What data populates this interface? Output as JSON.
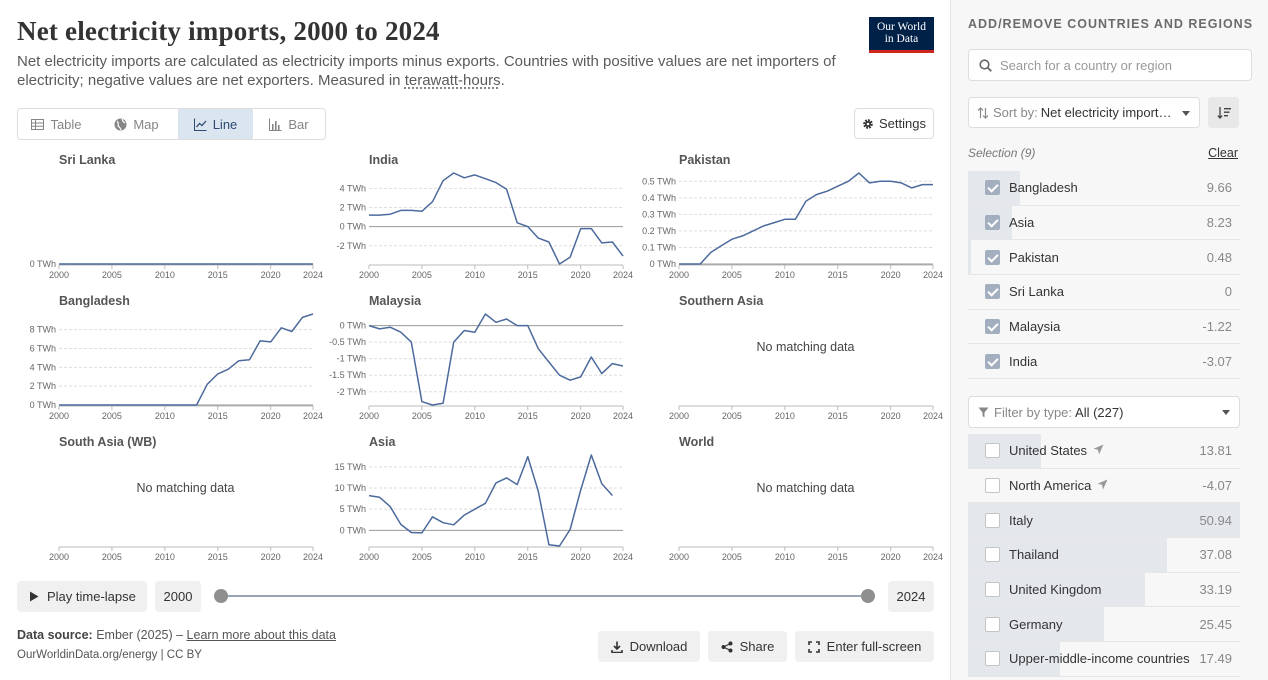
{
  "title": "Net electricity imports, 2000 to 2024",
  "subtitle_text": "Net electricity imports are calculated as electricity imports minus exports. Countries with positive values are net importers of electricity; negative values are net exporters. Measured in ",
  "subtitle_link": "terawatt-hours",
  "subtitle_end": ".",
  "logo": {
    "line1": "Our World",
    "line2": "in Data"
  },
  "tabs": [
    {
      "label": "Table",
      "icon": "table-icon"
    },
    {
      "label": "Map",
      "icon": "globe-icon"
    },
    {
      "label": "Line",
      "icon": "line-chart-icon",
      "active": true
    },
    {
      "label": "Bar",
      "icon": "bar-chart-icon"
    }
  ],
  "settings_label": "Settings",
  "no_data_label": "No matching data",
  "chart_data": [
    {
      "type": "line",
      "title": "Sri Lanka",
      "x": [
        2000,
        2024
      ],
      "y": [
        0,
        0
      ],
      "yticks": [
        0
      ],
      "ylim": [
        0,
        0.1
      ],
      "unit": "TWh"
    },
    {
      "type": "line",
      "title": "India",
      "x": [
        2000,
        2001,
        2002,
        2003,
        2004,
        2005,
        2006,
        2007,
        2008,
        2009,
        2010,
        2011,
        2012,
        2013,
        2014,
        2015,
        2016,
        2017,
        2018,
        2019,
        2020,
        2021,
        2022,
        2023,
        2024
      ],
      "y": [
        1.2,
        1.2,
        1.3,
        1.7,
        1.7,
        1.6,
        2.6,
        4.8,
        5.6,
        5.1,
        5.4,
        5.0,
        4.6,
        3.9,
        0.4,
        0.0,
        -1.2,
        -1.6,
        -3.9,
        -3.2,
        -0.2,
        -0.2,
        -1.7,
        -1.6,
        -3.07
      ],
      "yticks": [
        -2,
        0,
        2,
        4
      ],
      "ylim": [
        -3.9,
        5.6
      ],
      "unit": "TWh"
    },
    {
      "type": "line",
      "title": "Pakistan",
      "x": [
        2000,
        2001,
        2002,
        2003,
        2004,
        2005,
        2006,
        2007,
        2008,
        2009,
        2010,
        2011,
        2012,
        2013,
        2014,
        2015,
        2016,
        2017,
        2018,
        2019,
        2020,
        2021,
        2022,
        2023,
        2024
      ],
      "y": [
        0,
        0,
        0,
        0.07,
        0.11,
        0.15,
        0.17,
        0.2,
        0.23,
        0.25,
        0.27,
        0.27,
        0.38,
        0.42,
        0.44,
        0.47,
        0.5,
        0.55,
        0.49,
        0.5,
        0.5,
        0.49,
        0.46,
        0.48,
        0.48
      ],
      "yticks": [
        0,
        0.1,
        0.2,
        0.3,
        0.4,
        0.5
      ],
      "ylim": [
        0,
        0.55
      ],
      "unit": "TWh"
    },
    {
      "type": "line",
      "title": "Bangladesh",
      "x": [
        2000,
        2001,
        2002,
        2003,
        2004,
        2005,
        2006,
        2007,
        2008,
        2009,
        2010,
        2011,
        2012,
        2013,
        2014,
        2015,
        2016,
        2017,
        2018,
        2019,
        2020,
        2021,
        2022,
        2023,
        2024
      ],
      "y": [
        0,
        0,
        0,
        0,
        0,
        0,
        0,
        0,
        0,
        0,
        0,
        0,
        0,
        0,
        2.2,
        3.3,
        3.8,
        4.7,
        4.8,
        6.8,
        6.7,
        8.2,
        7.8,
        9.3,
        9.66
      ],
      "yticks": [
        0,
        2,
        4,
        6,
        8
      ],
      "ylim": [
        0,
        9.66
      ],
      "unit": "TWh"
    },
    {
      "type": "line",
      "title": "Malaysia",
      "x": [
        2000,
        2001,
        2002,
        2003,
        2004,
        2005,
        2006,
        2007,
        2008,
        2009,
        2010,
        2011,
        2012,
        2013,
        2014,
        2015,
        2016,
        2017,
        2018,
        2019,
        2020,
        2021,
        2022,
        2023,
        2024
      ],
      "y": [
        0,
        -0.1,
        -0.05,
        -0.2,
        -0.5,
        -2.3,
        -2.4,
        -2.35,
        -0.5,
        -0.15,
        -0.2,
        0.35,
        0.1,
        0.2,
        0.0,
        0.0,
        -0.7,
        -1.1,
        -1.5,
        -1.65,
        -1.55,
        -0.95,
        -1.45,
        -1.15,
        -1.22
      ],
      "yticks": [
        -2,
        -1.5,
        -1,
        -0.5,
        0
      ],
      "ylim": [
        -2.4,
        0.35
      ],
      "unit": "TWh"
    },
    {
      "type": "line",
      "title": "Southern Asia",
      "no_data": true
    },
    {
      "type": "line",
      "title": "South Asia (WB)",
      "no_data": true
    },
    {
      "type": "line",
      "title": "Asia",
      "x": [
        2000,
        2001,
        2002,
        2003,
        2004,
        2005,
        2006,
        2007,
        2008,
        2009,
        2010,
        2011,
        2012,
        2013,
        2014,
        2015,
        2016,
        2017,
        2018,
        2019,
        2020,
        2021,
        2022,
        2023,
        2024
      ],
      "y": [
        8.2,
        7.8,
        5.6,
        1.4,
        -0.5,
        -0.6,
        3.2,
        1.8,
        1.3,
        3.6,
        5.0,
        6.4,
        11.2,
        12.4,
        10.8,
        17.4,
        9.2,
        -3.4,
        -3.7,
        0.2,
        9.5,
        17.8,
        11.0,
        8.23
      ],
      "yticks": [
        0,
        5,
        10,
        15
      ],
      "ylim": [
        -3.7,
        17.8
      ],
      "unit": "TWh"
    },
    {
      "type": "line",
      "title": "World",
      "no_data": true
    }
  ],
  "xticks": [
    "2000",
    "2005",
    "2010",
    "2015",
    "2020",
    "2024"
  ],
  "timeline": {
    "play_label": "Play time-lapse",
    "start": "2000",
    "end": "2024"
  },
  "source": {
    "label": "Data source:",
    "text": "Ember (2025) – ",
    "link": "Learn more about this data"
  },
  "url_text": "OurWorldinData.org/energy | CC BY",
  "actions": {
    "download": "Download",
    "share": "Share",
    "fullscreen": "Enter full-screen"
  },
  "sidebar": {
    "title": "ADD/REMOVE COUNTRIES AND REGIONS",
    "search_placeholder": "Search for a country or region",
    "sort_label": "Sort by:",
    "sort_value": "Net electricity import…",
    "selection_label": "Selection (9)",
    "clear_label": "Clear",
    "selected": [
      {
        "name": "Bangladesh",
        "value": "9.66",
        "frac": 0.19
      },
      {
        "name": "Asia",
        "value": "8.23",
        "frac": 0.16
      },
      {
        "name": "Pakistan",
        "value": "0.48",
        "frac": 0.01
      },
      {
        "name": "Sri Lanka",
        "value": "0",
        "frac": 0
      },
      {
        "name": "Malaysia",
        "value": "-1.22",
        "frac": 0
      },
      {
        "name": "India",
        "value": "-3.07",
        "frac": 0
      }
    ],
    "filter_label": "Filter by type:",
    "filter_value": "All (227)",
    "available": [
      {
        "name": "United States",
        "value": "13.81",
        "frac": 0.27,
        "locate": true
      },
      {
        "name": "North America",
        "value": "-4.07",
        "frac": 0,
        "locate": true
      },
      {
        "name": "Italy",
        "value": "50.94",
        "frac": 1.0
      },
      {
        "name": "Thailand",
        "value": "37.08",
        "frac": 0.73
      },
      {
        "name": "United Kingdom",
        "value": "33.19",
        "frac": 0.65
      },
      {
        "name": "Germany",
        "value": "25.45",
        "frac": 0.5
      },
      {
        "name": "Upper-middle-income countries",
        "value": "17.49",
        "frac": 0.34
      }
    ]
  }
}
